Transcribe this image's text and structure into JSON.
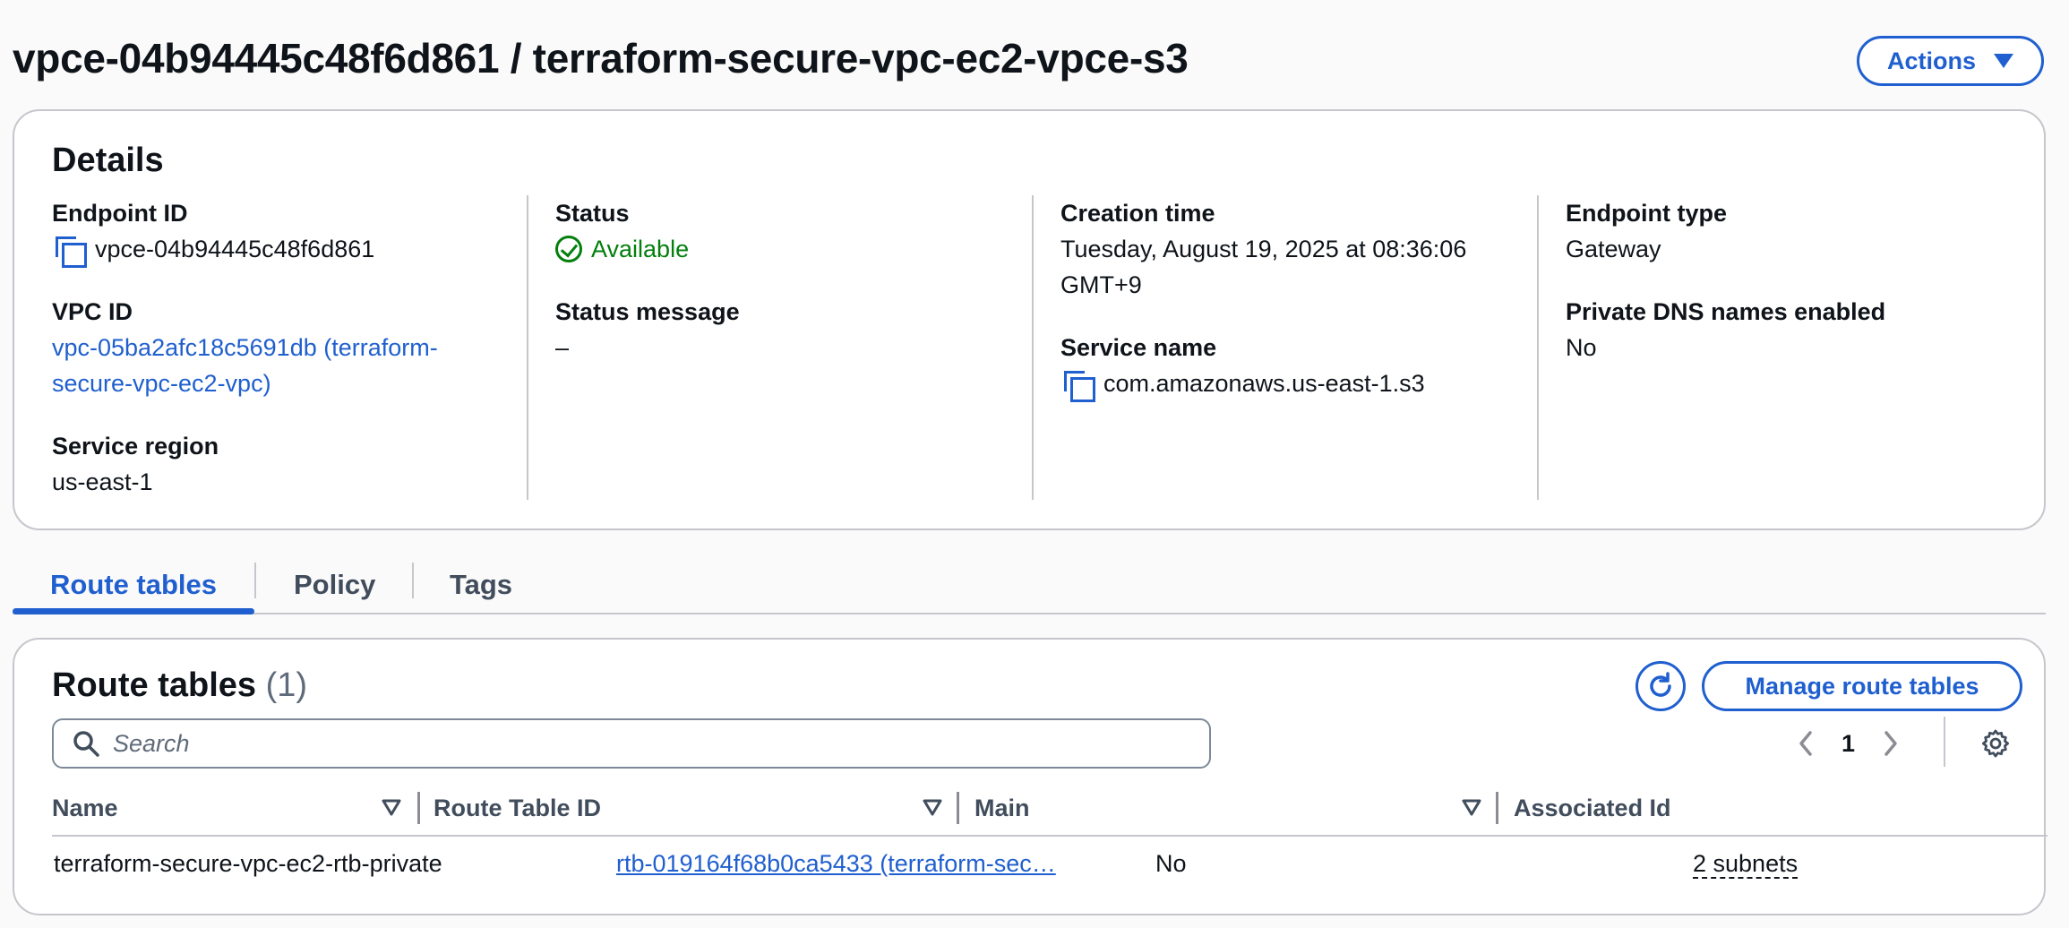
{
  "header": {
    "title": "vpce-04b94445c48f6d861 / terraform-secure-vpc-ec2-vpce-s3",
    "actions_label": "Actions"
  },
  "details": {
    "title": "Details",
    "endpoint_id_label": "Endpoint ID",
    "endpoint_id": "vpce-04b94445c48f6d861",
    "vpc_id_label": "VPC ID",
    "vpc_id_line1": "vpc-05ba2afc18c5691db (terraform-",
    "vpc_id_line2": "secure-vpc-ec2-vpc)",
    "service_region_label": "Service region",
    "service_region": "us-east-1",
    "status_label": "Status",
    "status": "Available",
    "status_message_label": "Status message",
    "status_message": "–",
    "creation_time_label": "Creation time",
    "creation_time_line1": "Tuesday, August 19, 2025 at 08:36:06",
    "creation_time_line2": "GMT+9",
    "service_name_label": "Service name",
    "service_name": "com.amazonaws.us-east-1.s3",
    "endpoint_type_label": "Endpoint type",
    "endpoint_type": "Gateway",
    "private_dns_label": "Private DNS names enabled",
    "private_dns": "No"
  },
  "tabs": [
    {
      "label": "Route tables",
      "active": true
    },
    {
      "label": "Policy",
      "active": false
    },
    {
      "label": "Tags",
      "active": false
    }
  ],
  "route_tables": {
    "title": "Route tables",
    "count": "(1)",
    "manage_label": "Manage route tables",
    "search_placeholder": "Search",
    "page": "1",
    "columns": [
      "Name",
      "Route Table ID",
      "Main",
      "Associated Id"
    ],
    "rows": [
      {
        "name": "terraform-secure-vpc-ec2-rtb-private",
        "route_table_id": "rtb-019164f68b0ca5433 (terraform-sec…",
        "main": "No",
        "associated_id": "2 subnets"
      }
    ]
  },
  "colors": {
    "accent": "#1f5fcf",
    "success": "#037f0c",
    "border": "#c6c6cd"
  }
}
